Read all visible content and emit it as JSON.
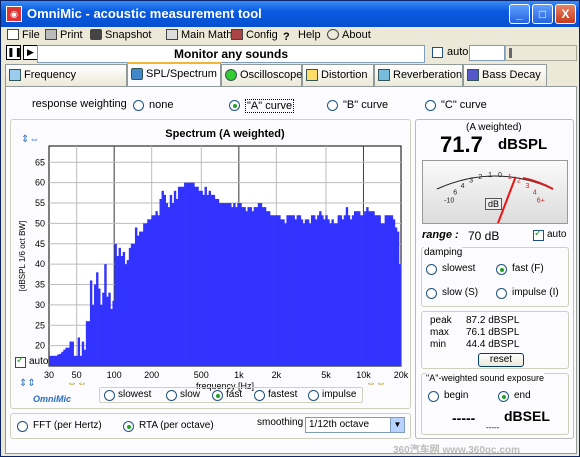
{
  "window": {
    "title": "OmniMic - acoustic measurement tool",
    "app_icon": "omnimic-icon",
    "controls": {
      "minimize": "_",
      "maximize": "□",
      "close": "X"
    }
  },
  "menu": [
    {
      "label": "File",
      "icon": "file-icon"
    },
    {
      "label": "Print",
      "icon": "print-icon"
    },
    {
      "label": "Snapshot",
      "icon": "camera-icon"
    },
    {
      "label": "Main Math",
      "icon": "calculator-icon"
    },
    {
      "label": "Config",
      "icon": "config-icon"
    },
    {
      "label": "Help",
      "icon": "help-icon"
    },
    {
      "label": "About",
      "icon": "about-icon"
    }
  ],
  "toolbar": {
    "status": "Monitor any sounds",
    "auto_label": "auto",
    "pause_icon": "pause-icon",
    "play_icon": "play-icon"
  },
  "tabs": [
    {
      "label": "Frequency Response",
      "icon": "frequency-response-icon",
      "active": false
    },
    {
      "label": "SPL/Spectrum",
      "icon": "spl-spectrum-icon",
      "active": true
    },
    {
      "label": "Oscilloscope",
      "icon": "oscilloscope-icon",
      "active": false
    },
    {
      "label": "Distortion",
      "icon": "distortion-icon",
      "active": false
    },
    {
      "label": "Reverberation",
      "icon": "reverberation-icon",
      "active": false
    },
    {
      "label": "Bass Decay",
      "icon": "bass-decay-icon",
      "active": false
    }
  ],
  "weighting": {
    "label": "response weighting",
    "options": [
      "none",
      "\"A\" curve",
      "\"B\" curve",
      "\"C\" curve"
    ],
    "selected": "\"A\" curve"
  },
  "chart_data": {
    "type": "bar",
    "title": "Spectrum (A weighted)",
    "ylabel": "[dBSPL 1/6 oct BW]",
    "xlabel": "frequency [Hz]",
    "x_scale": "log",
    "xlim": [
      30,
      20000
    ],
    "ylim": [
      15,
      69
    ],
    "y_ticks": [
      20,
      25,
      30,
      35,
      40,
      45,
      50,
      55,
      60,
      65
    ],
    "x_ticks": [
      "30",
      "50",
      "100",
      "200",
      "500",
      "1k",
      "2k",
      "5k",
      "10k",
      "20k"
    ],
    "bar_color": "#3333ff",
    "grid": true,
    "resolution": "1/12th octave",
    "values": [
      17.5,
      17.5,
      17.5,
      17.5,
      17.8,
      18,
      18.5,
      19,
      19.5,
      19.5,
      21,
      21,
      17.5,
      17.5,
      22,
      17.5,
      21,
      19,
      26,
      26,
      36,
      30,
      35,
      38,
      34,
      30,
      33,
      40,
      32,
      33,
      29,
      31,
      45,
      42,
      44,
      42,
      43,
      40,
      41,
      44,
      45,
      45,
      49,
      47,
      48,
      48,
      50,
      50,
      51,
      51,
      52,
      52,
      53,
      52,
      56,
      58,
      57,
      55,
      54,
      57,
      55,
      58,
      56,
      59,
      59,
      59,
      60,
      60,
      60,
      60,
      60,
      59,
      59,
      58,
      58,
      57,
      59,
      57,
      58,
      57,
      57,
      56,
      56,
      55,
      55,
      55,
      55,
      55,
      55,
      54,
      55,
      54,
      55,
      55,
      54,
      54,
      53,
      54,
      54,
      53,
      54,
      54,
      55,
      55,
      54,
      54,
      53,
      53,
      52,
      52,
      52,
      52,
      52,
      51,
      51,
      50,
      52,
      52,
      52,
      52,
      51,
      52,
      52,
      51,
      50,
      51,
      51,
      50,
      52,
      52,
      51,
      52,
      53,
      52,
      51,
      52,
      51,
      50,
      51,
      50,
      50,
      52,
      52,
      51,
      52,
      54,
      52,
      51,
      52,
      53,
      53,
      53,
      52,
      52,
      53,
      54,
      53,
      53,
      53,
      52,
      52,
      52,
      50,
      50,
      52,
      52,
      52,
      52,
      51,
      49,
      48,
      40
    ]
  },
  "chart_footer": {
    "auto_label": "auto",
    "brand": "OmniMic",
    "speed_options": [
      "slowest",
      "slow",
      "fast",
      "fastest",
      "impulse"
    ],
    "speed_selected": "fast"
  },
  "bottom": {
    "mode_options": [
      "FFT (per Hertz)",
      "RTA (per octave)"
    ],
    "mode_selected": "RTA (per octave)",
    "smoothing_label": "smoothing",
    "smoothing_value": "1/12th octave"
  },
  "meter": {
    "weighting_label": "(A weighted)",
    "value": "71.7",
    "unit": "dBSPL",
    "scale_labels": [
      "-10",
      "6",
      "4",
      "3",
      "2",
      "1",
      "0",
      "1",
      "2",
      "3",
      "4",
      "6+"
    ],
    "db_label": "dB",
    "range_label": "range :",
    "range_value": "70 dB",
    "needle_level": 0.68,
    "auto_label": "auto",
    "damping_label": "damping",
    "damping_options": [
      "slowest",
      "fast (F)",
      "slow (S)",
      "impulse (I)"
    ],
    "damping_selected": "fast (F)"
  },
  "stats": {
    "rows": [
      {
        "label": "peak",
        "value": "87.2 dBSPL"
      },
      {
        "label": "max",
        "value": "76.1 dBSPL"
      },
      {
        "label": "min",
        "value": "44.4 dBSPL"
      }
    ],
    "reset_label": "reset"
  },
  "exposure": {
    "title": "\"A\"-weighted sound exposure",
    "options": [
      "begin",
      "end"
    ],
    "selected": "end",
    "value": "-----",
    "unit": "dBSEL",
    "sub": "-----"
  },
  "watermark": "360汽车网 www.360qc.com"
}
